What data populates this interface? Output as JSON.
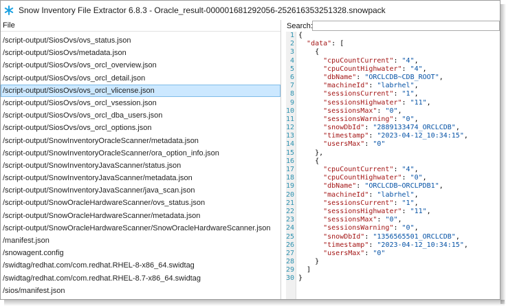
{
  "window": {
    "title": "Snow Inventory File Extractor 6.8.3 - Oracle_result-000001681292056-252616353251328.snowpack",
    "accent_color": "#1ba1e2"
  },
  "left_pane": {
    "header": "File",
    "files": [
      "/script-output/SiosOvs/ovs_status.json",
      "/script-output/SiosOvs/metadata.json",
      "/script-output/SiosOvs/ovs_orcl_overview.json",
      "/script-output/SiosOvs/ovs_orcl_detail.json",
      "/script-output/SiosOvs/ovs_orcl_vlicense.json",
      "/script-output/SiosOvs/ovs_orcl_vsession.json",
      "/script-output/SiosOvs/ovs_orcl_dba_users.json",
      "/script-output/SiosOvs/ovs_orcl_options.json",
      "/script-output/SnowInventoryOracleScanner/metadata.json",
      "/script-output/SnowInventoryOracleScanner/ora_option_info.json",
      "/script-output/SnowInventoryJavaScanner/status.json",
      "/script-output/SnowInventoryJavaScanner/metadata.json",
      "/script-output/SnowInventoryJavaScanner/java_scan.json",
      "/script-output/SnowOracleHardwareScanner/ovs_status.json",
      "/script-output/SnowOracleHardwareScanner/metadata.json",
      "/script-output/SnowOracleHardwareScanner/SnowOracleHardwareScanner.json",
      "/manifest.json",
      "/snowagent.config",
      "/swidtag/redhat.com/com.redhat.RHEL-8-x86_64.swidtag",
      "/swidtag/redhat.com/com.redhat.RHEL-8.7-x86_64.swidtag",
      "/sios/manifest.json"
    ],
    "selected_index": 4
  },
  "right_pane": {
    "search_label": "Search:",
    "search_value": "",
    "code_lines": [
      {
        "n": "1",
        "t": "{"
      },
      {
        "n": "2",
        "t": "  \"data\": ["
      },
      {
        "n": "3",
        "t": "    {"
      },
      {
        "n": "4",
        "t": "      \"cpuCountCurrent\": \"4\","
      },
      {
        "n": "5",
        "t": "      \"cpuCountHighwater\": \"4\","
      },
      {
        "n": "6",
        "t": "      \"dbName\": \"ORCLCDB~CDB_ROOT\","
      },
      {
        "n": "7",
        "t": "      \"machineId\": \"labrhel\","
      },
      {
        "n": "8",
        "t": "      \"sessionsCurrent\": \"1\","
      },
      {
        "n": "9",
        "t": "      \"sessionsHighwater\": \"11\","
      },
      {
        "n": "10",
        "t": "      \"sessionsMax\": \"0\","
      },
      {
        "n": "11",
        "t": "      \"sessionsWarning\": \"0\","
      },
      {
        "n": "12",
        "t": "      \"snowDbId\": \"2889133474_ORCLCDB\","
      },
      {
        "n": "13",
        "t": "      \"timestamp\": \"2023-04-12_10:34:15\","
      },
      {
        "n": "14",
        "t": "      \"usersMax\": \"0\""
      },
      {
        "n": "15",
        "t": "    },"
      },
      {
        "n": "16",
        "t": "    {"
      },
      {
        "n": "17",
        "t": "      \"cpuCountCurrent\": \"4\","
      },
      {
        "n": "18",
        "t": "      \"cpuCountHighwater\": \"0\","
      },
      {
        "n": "19",
        "t": "      \"dbName\": \"ORCLCDB~ORCLPDB1\","
      },
      {
        "n": "20",
        "t": "      \"machineId\": \"labrhel\","
      },
      {
        "n": "21",
        "t": "      \"sessionsCurrent\": \"1\","
      },
      {
        "n": "22",
        "t": "      \"sessionsHighwater\": \"11\","
      },
      {
        "n": "23",
        "t": "      \"sessionsMax\": \"0\","
      },
      {
        "n": "24",
        "t": "      \"sessionsWarning\": \"0\","
      },
      {
        "n": "25",
        "t": "      \"snowDbId\": \"1356565501_ORCLCDB\","
      },
      {
        "n": "26",
        "t": "      \"timestamp\": \"2023-04-12_10:34:15\","
      },
      {
        "n": "27",
        "t": "      \"usersMax\": \"0\""
      },
      {
        "n": "28",
        "t": "    }"
      },
      {
        "n": "29",
        "t": "  ]"
      },
      {
        "n": "30",
        "t": "}"
      }
    ]
  }
}
